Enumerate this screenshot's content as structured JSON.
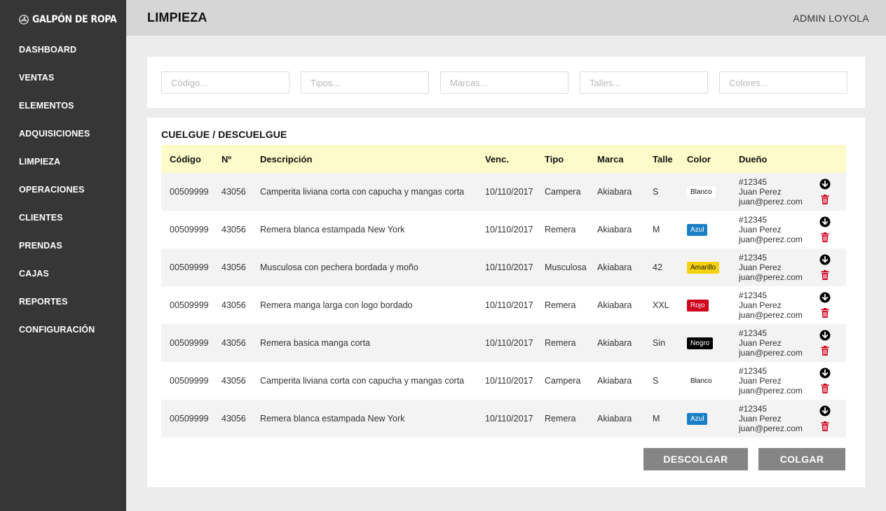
{
  "brand": {
    "name": "GALPÓN DE ROPA",
    "logo_icon": "hanger-circle-icon"
  },
  "sidebar": {
    "items": [
      {
        "key": "dashboard",
        "label": "DASHBOARD"
      },
      {
        "key": "ventas",
        "label": "VENTAS"
      },
      {
        "key": "elementos",
        "label": "ELEMENTOS"
      },
      {
        "key": "adquisiciones",
        "label": "ADQUISICIONES"
      },
      {
        "key": "limpieza",
        "label": "LIMPIEZA"
      },
      {
        "key": "operaciones",
        "label": "OPERACIONES"
      },
      {
        "key": "clientes",
        "label": "CLIENTES"
      },
      {
        "key": "prendas",
        "label": "PRENDAS"
      },
      {
        "key": "cajas",
        "label": "CAJAS"
      },
      {
        "key": "reportes",
        "label": "REPORTES"
      },
      {
        "key": "configuracion",
        "label": "CONFIGURACIÓN"
      }
    ]
  },
  "header": {
    "title": "LIMPIEZA",
    "user": "ADMIN LOYOLA"
  },
  "filters": {
    "codigo_placeholder": "Código...",
    "tipos_placeholder": "Tipos...",
    "marcas_placeholder": "Marcas...",
    "talles_placeholder": "Talles...",
    "colores_placeholder": "Colores..."
  },
  "section": {
    "title": "CUELGUE / DESCUELGUE"
  },
  "table": {
    "columns": [
      "Código",
      "Nº",
      "Descripción",
      "Venc.",
      "Tipo",
      "Marca",
      "Talle",
      "Color",
      "Dueño"
    ],
    "rows": [
      {
        "codigo": "00509999",
        "numero": "43056",
        "descripcion": "Camperita liviana corta con capucha y mangas corta",
        "venc": "10/110/2017",
        "tipo": "Campera",
        "marca": "Akiabara",
        "talle": "S",
        "color": "Blanco",
        "color_bg": "#ffffff",
        "color_fg": "#111111",
        "owner_id": "#12345",
        "owner_name": "Juan Perez",
        "owner_email": "juan@perez.com"
      },
      {
        "codigo": "00509999",
        "numero": "43056",
        "descripcion": "Remera blanca estampada New York",
        "venc": "10/110/2017",
        "tipo": "Remera",
        "marca": "Akiabara",
        "talle": "M",
        "color": "Azul",
        "color_bg": "#1a7fc4",
        "color_fg": "#ffffff",
        "owner_id": "#12345",
        "owner_name": "Juan Perez",
        "owner_email": "juan@perez.com"
      },
      {
        "codigo": "00509999",
        "numero": "43056",
        "descripcion": "Musculosa con pechera bordada y moño",
        "venc": "10/110/2017",
        "tipo": "Musculosa",
        "marca": "Akiabara",
        "talle": "42",
        "color": "Amarillo",
        "color_bg": "#f7d20e",
        "color_fg": "#111111",
        "owner_id": "#12345",
        "owner_name": "Juan Perez",
        "owner_email": "juan@perez.com"
      },
      {
        "codigo": "00509999",
        "numero": "43056",
        "descripcion": "Remera manga larga con logo bordado",
        "venc": "10/110/2017",
        "tipo": "Remera",
        "marca": "Akiabara",
        "talle": "XXL",
        "color": "Rojo",
        "color_bg": "#d0021b",
        "color_fg": "#ffffff",
        "owner_id": "#12345",
        "owner_name": "Juan Perez",
        "owner_email": "juan@perez.com"
      },
      {
        "codigo": "00509999",
        "numero": "43056",
        "descripcion": "Remera basica manga corta",
        "venc": "10/110/2017",
        "tipo": "Remera",
        "marca": "Akiabara",
        "talle": "Sin",
        "color": "Negro",
        "color_bg": "#000000",
        "color_fg": "#ffffff",
        "owner_id": "#12345",
        "owner_name": "Juan Perez",
        "owner_email": "juan@perez.com"
      },
      {
        "codigo": "00509999",
        "numero": "43056",
        "descripcion": "Camperita liviana corta con capucha y mangas corta",
        "venc": "10/110/2017",
        "tipo": "Campera",
        "marca": "Akiabara",
        "talle": "S",
        "color": "Blanco",
        "color_bg": "#ffffff",
        "color_fg": "#111111",
        "owner_id": "#12345",
        "owner_name": "Juan Perez",
        "owner_email": "juan@perez.com"
      },
      {
        "codigo": "00509999",
        "numero": "43056",
        "descripcion": "Remera blanca estampada New York",
        "venc": "10/110/2017",
        "tipo": "Remera",
        "marca": "Akiabara",
        "talle": "M",
        "color": "Azul",
        "color_bg": "#1a7fc4",
        "color_fg": "#ffffff",
        "owner_id": "#12345",
        "owner_name": "Juan Perez",
        "owner_email": "juan@perez.com"
      }
    ],
    "row_action_icons": {
      "hang": "arrow-down-circle-icon",
      "delete": "trash-icon"
    }
  },
  "actions": {
    "descolgar_label": "DESCOLGAR",
    "colgar_label": "COLGAR"
  },
  "colors": {
    "sidebar_bg": "#363636",
    "header_bg": "#d6d6d6",
    "table_header_bg": "#fdfbc9",
    "button_bg": "#858585",
    "delete_red": "#d0021b"
  }
}
